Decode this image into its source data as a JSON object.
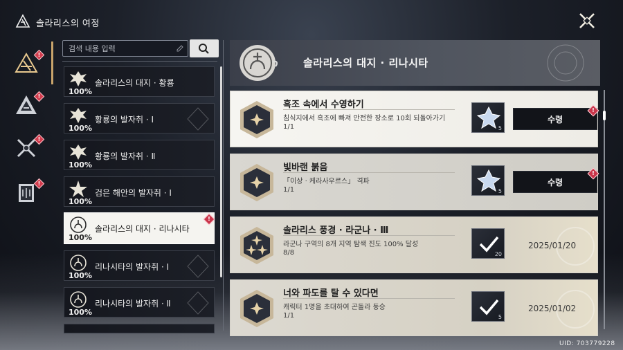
{
  "header": {
    "title": "솔라리스의 여정",
    "close_icon": "close-x-icon"
  },
  "left_nav": {
    "items": [
      {
        "icon": "solaris-journey-icon",
        "badge": "!",
        "active": true
      },
      {
        "icon": "triangle-emblem-icon",
        "badge": "!"
      },
      {
        "icon": "crossed-swords-icon",
        "badge": "!"
      },
      {
        "icon": "collection-book-icon",
        "badge": "!"
      }
    ]
  },
  "search": {
    "placeholder": "검색 내용 입력",
    "button_icon": "search-icon"
  },
  "list": {
    "items": [
      {
        "title": "솔라리스의 대지 · 황룡",
        "percent": "100%",
        "emblem": "dragon-emblem-icon"
      },
      {
        "title": "황룡의 발자취 · Ⅰ",
        "percent": "100%",
        "emblem": "dragon-emblem-icon"
      },
      {
        "title": "황룡의 발자취 · Ⅱ",
        "percent": "100%",
        "emblem": "dragon-emblem-icon"
      },
      {
        "title": "검은 해안의 발자취 · Ⅰ",
        "percent": "100%",
        "emblem": "star-emblem-icon"
      },
      {
        "title": "솔라리스의 대지 · 리나시타",
        "percent": "100%",
        "emblem": "rinascita-emblem-icon",
        "active": true,
        "badge": "!"
      },
      {
        "title": "리나시타의 발자취 · Ⅰ",
        "percent": "100%",
        "emblem": "rinascita-emblem-icon"
      },
      {
        "title": "리나시타의 발자취 · Ⅱ",
        "percent": "100%",
        "emblem": "rinascita-emblem-icon"
      }
    ]
  },
  "detail": {
    "title": "솔라리스의 대지 · 리나시타",
    "achievements": [
      {
        "title": "흑조 속에서 수영하기",
        "desc": "침식지에서 흑조에 빠져 안전한 장소로 10회 되돌아가기",
        "progress": "1/1",
        "reward_count": "5",
        "action": "수령",
        "status": "claimable",
        "badge": "!"
      },
      {
        "title": "빛바랜 붉음",
        "desc": "「이상 · 케라사우르스」 격파",
        "progress": "1/1",
        "reward_count": "5",
        "action": "수령",
        "status": "claimable",
        "badge": "!"
      },
      {
        "title": "솔라리스 풍경 · 라군나 · Ⅲ",
        "desc": "라군나 구역의 8개 지역 탐색 진도 100% 달성",
        "progress": "8/8",
        "reward_count": "20",
        "date": "2025/01/20",
        "status": "done"
      },
      {
        "title": "너와 파도를 탈 수 있다면",
        "desc": "캐릭터 1명을 초대하여 곤돌라 동승",
        "progress": "1/1",
        "reward_count": "5",
        "date": "2025/01/02",
        "status": "done"
      }
    ]
  },
  "footer": {
    "uid": "UID: 703779228"
  }
}
